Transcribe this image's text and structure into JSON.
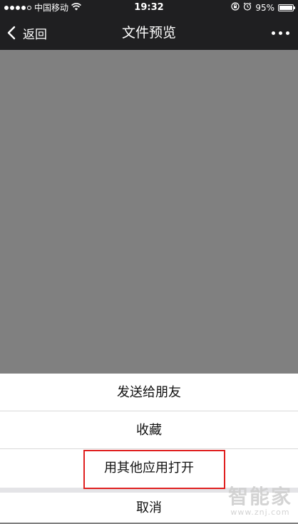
{
  "status_bar": {
    "carrier": "中国移动",
    "time": "19:32",
    "battery_percent": "95%",
    "signal_bars_filled": 4,
    "signal_bars_total": 5,
    "icons": [
      "wifi-icon",
      "lock-rotation-icon",
      "alarm-icon",
      "battery-icon"
    ]
  },
  "nav": {
    "back_label": "返回",
    "title": "文件预览",
    "more_icon": "more-dots-icon"
  },
  "action_sheet": {
    "items": [
      {
        "label": "发送给朋友"
      },
      {
        "label": "收藏"
      },
      {
        "label": "用其他应用打开"
      }
    ],
    "cancel_label": "取消"
  },
  "watermark": {
    "text": "智能家",
    "url": "www.znj.com"
  },
  "colors": {
    "top_bar": "#1f1f21",
    "preview_bg": "#808080",
    "highlight": "#e02020"
  }
}
